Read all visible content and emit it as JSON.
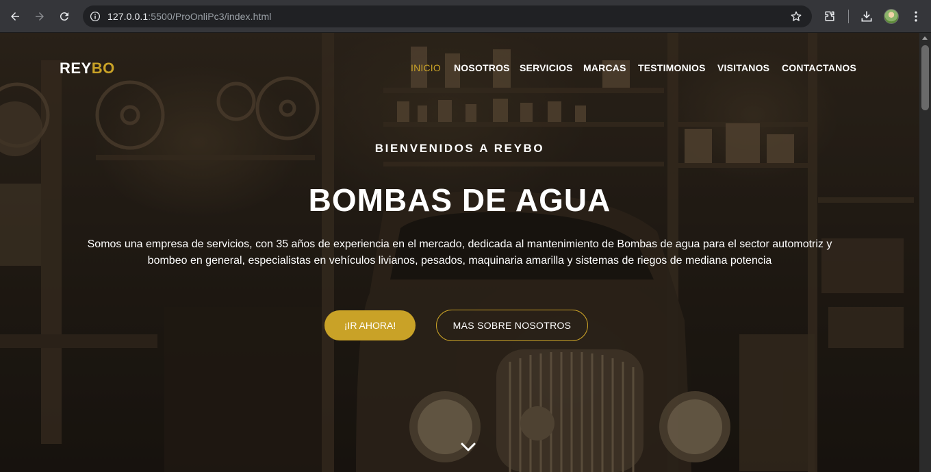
{
  "browser": {
    "url_host": "127.0.0.1",
    "url_path": ":5500/ProOnliPc3/index.html",
    "icons": [
      "back-arrow-icon",
      "forward-arrow-icon",
      "reload-icon",
      "info-icon",
      "star-icon",
      "extensions-icon",
      "download-icon",
      "profile-avatar",
      "more-vert-icon"
    ]
  },
  "site": {
    "logo_main": "REY",
    "logo_accent": "BO",
    "accent_color": "#c9a227",
    "menu": [
      {
        "label": "INICIO",
        "active": true
      },
      {
        "label": "NOSOTROS",
        "active": false
      },
      {
        "label": "SERVICIOS",
        "active": false
      },
      {
        "label": "MARCAS",
        "active": false
      },
      {
        "label": "TESTIMONIOS",
        "active": false
      },
      {
        "label": "VISITANOS",
        "active": false
      },
      {
        "label": "CONTACTANOS",
        "active": false
      }
    ]
  },
  "hero": {
    "kicker": "BIENVENIDOS A REYBO",
    "title": "BOMBAS DE AGUA",
    "text_line1": "Somos una empresa de servicios, con 35 años de experiencia en el mercado, dedicada al mantenimiento de Bombas de agua para el sector automotriz y",
    "text_line2": "bombeo en general, especialistas en vehículos livianos, pesados, maquinaria amarilla y sistemas de riegos de mediana potencia",
    "primary_button": "¡IR AHORA!",
    "secondary_button": "MAS SOBRE NOSOTROS",
    "scroll_icon": "chevron-down-icon"
  }
}
